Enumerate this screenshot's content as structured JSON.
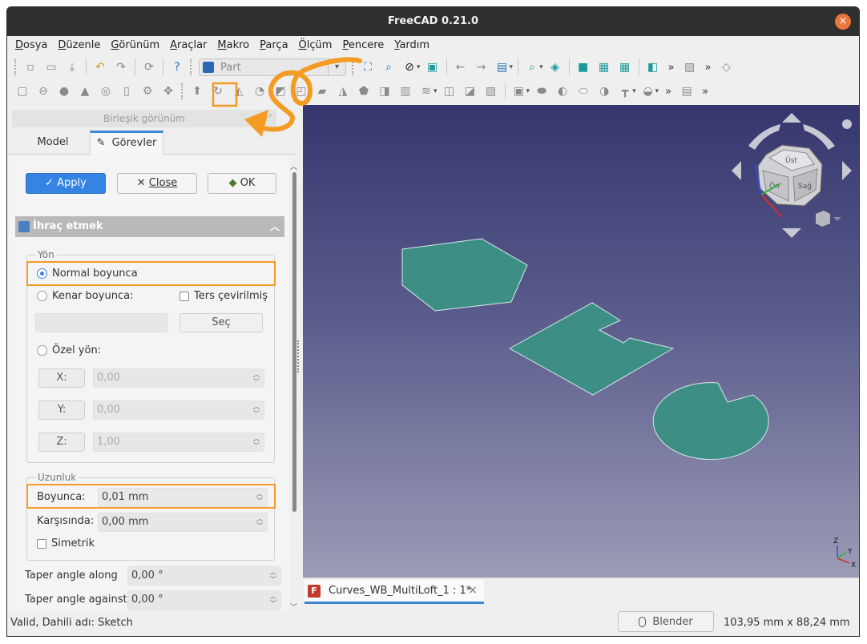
{
  "window": {
    "title": "FreeCAD 0.21.0",
    "close_glyph": "×"
  },
  "menu": {
    "items": [
      {
        "label_acc": "D",
        "label_rest": "osya"
      },
      {
        "label_acc": "D",
        "label_rest": "üzenle"
      },
      {
        "label_acc": "G",
        "label_rest": "örünüm"
      },
      {
        "label_acc": "A",
        "label_rest": "raçlar"
      },
      {
        "label_acc": "M",
        "label_rest": "akro"
      },
      {
        "label_acc": "P",
        "label_rest": "arça"
      },
      {
        "label_acc": "Ö",
        "label_rest": "lçüm"
      },
      {
        "label_acc": "P",
        "label_rest": "encere"
      },
      {
        "label_acc": "Y",
        "label_rest": "ardım"
      }
    ]
  },
  "toolbar": {
    "workbench": "Part",
    "more": "»"
  },
  "panel": {
    "title": "Birleşik görünüm",
    "tabs": {
      "model": "Model",
      "tasks": "Görevler"
    },
    "buttons": {
      "apply": "Apply",
      "close": "Close",
      "ok": "OK"
    },
    "section": "İhraç etmek",
    "direction": {
      "group_label": "Yön",
      "normal": "Normal boyunca",
      "edge": "Kenar boyunca:",
      "reversed": "Ters çevirilmiş",
      "select": "Seç",
      "custom": "Özel yön:",
      "x_label": "X:",
      "x_value": "0,00",
      "y_label": "Y:",
      "y_value": "0,00",
      "z_label": "Z:",
      "z_value": "1,00"
    },
    "length": {
      "group_label": "Uzunluk",
      "along_label": "Boyunca:",
      "along_value": "0,01 mm",
      "against_label": "Karşısında:",
      "against_value": "0,00 mm",
      "symmetric": "Simetrik"
    },
    "taper": {
      "along_label": "Taper angle along",
      "along_value": "0,00 °",
      "against_label": "Taper angle against",
      "against_value": "0,00 °"
    }
  },
  "viewport": {
    "shape_color": "#3d8f86",
    "background_top": "#36366e",
    "background_bottom": "#9b9cb6",
    "navcube": {
      "face_front": "Ön",
      "face_top": "Üst",
      "face_right": "Sağ"
    },
    "axis": {
      "x": "X",
      "y": "Y",
      "z": "Z"
    }
  },
  "document_tab": {
    "title": "Curves_WB_MultiLoft_1 : 1*",
    "close_glyph": "×"
  },
  "status": {
    "message": "Valid, Dahili adı: Sketch",
    "navigation_style": "Blender",
    "dimensions": "103,95 mm x 88,24 mm"
  },
  "annotation_color": "#f39b23"
}
